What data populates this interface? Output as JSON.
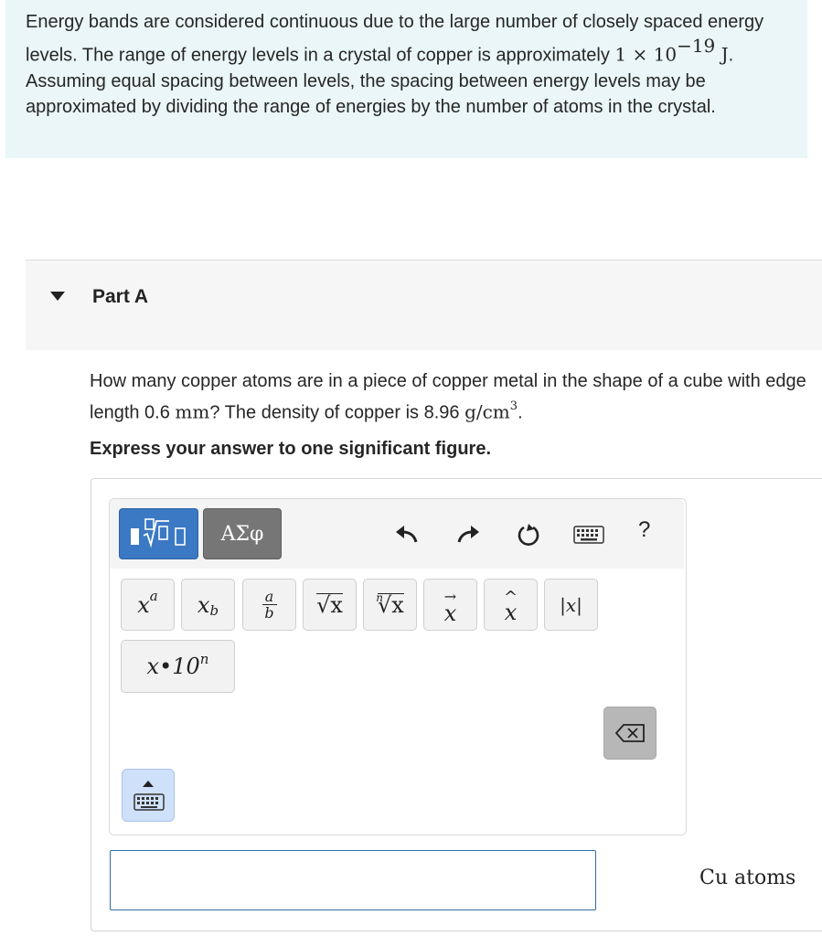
{
  "intro": {
    "text_1": "Energy bands are considered continuous due to the large number of closely spaced energy levels. The range of energy levels in a crystal of copper is approximately ",
    "math_coeff": "1 × 10",
    "math_exp": "−19",
    "math_unit": " J",
    "text_2": ". Assuming equal spacing between levels, the spacing between energy levels may be approximated by dividing the range of energies by the number of atoms in the crystal."
  },
  "part": {
    "title": "Part A"
  },
  "question": {
    "text_1": "How many copper atoms are in a piece of copper metal in the shape of a cube with edge length 0.6 ",
    "length_unit": "mm",
    "text_2": "? The density of copper is 8.96 ",
    "density_unit": "g/cm",
    "density_exp": "3",
    "text_3": "."
  },
  "instruction": "Express your answer to one significant figure.",
  "toolbar": {
    "greek_label": "ΑΣφ",
    "help_label": "?"
  },
  "templates": {
    "superscript_base": "x",
    "superscript_exp": "a",
    "subscript_base": "x",
    "subscript_sub": "b",
    "fraction_num": "a",
    "fraction_den": "b",
    "sqrt_label": "√x",
    "nthroot_index": "n",
    "nthroot_label": "√x",
    "vector_label": "x",
    "hat_label": "x",
    "abs_label": "|x|",
    "sci_label": "x•10",
    "sci_exp": "n"
  },
  "answer": {
    "value": "",
    "units": "Cu atoms"
  },
  "colors": {
    "intro_bg": "#eaf6f7",
    "active_mode": "#3b79c4",
    "inactive_mode": "#767676",
    "input_border": "#2e6da4"
  }
}
